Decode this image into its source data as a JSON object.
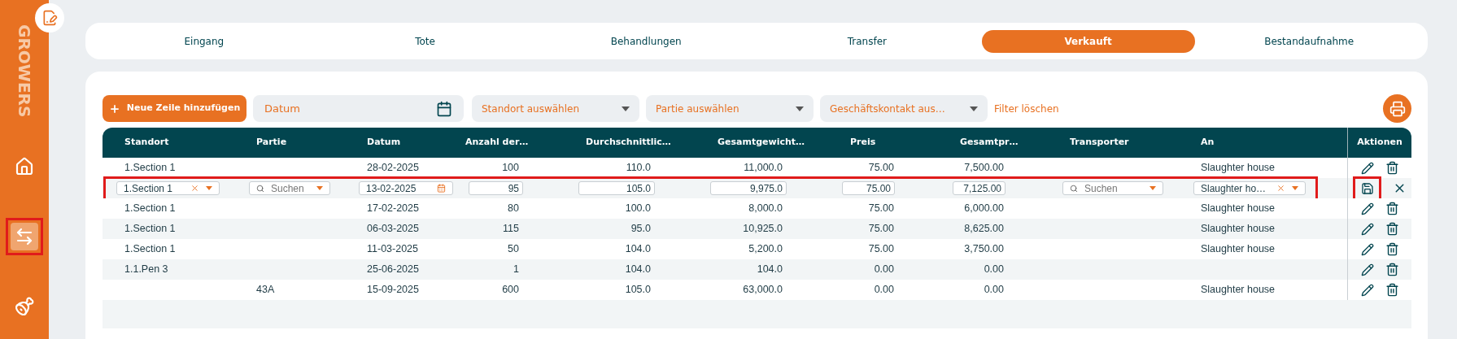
{
  "sidebar": {
    "brand": "GROWERS",
    "items": [
      {
        "kind": "home",
        "selected": false,
        "highlighted": false
      },
      {
        "kind": "transfer",
        "selected": true,
        "highlighted": true
      },
      {
        "kind": "ham",
        "selected": false,
        "highlighted": false
      }
    ]
  },
  "tabs": [
    {
      "label": "Eingang",
      "selected": false
    },
    {
      "label": "Tote",
      "selected": false
    },
    {
      "label": "Behandlungen",
      "selected": false
    },
    {
      "label": "Transfer",
      "selected": false
    },
    {
      "label": "Verkauft",
      "selected": true
    },
    {
      "label": "Bestandaufnahme",
      "selected": false
    }
  ],
  "toolbar": {
    "add_button": "Neue Zeile hinzufügen",
    "date_filter": {
      "placeholder": "Datum"
    },
    "selects": [
      {
        "placeholder": "Standort auswählen"
      },
      {
        "placeholder": "Partie auswählen"
      },
      {
        "placeholder": "Geschäftskontakt aus…"
      }
    ],
    "clear_filters": "Filter löschen"
  },
  "table": {
    "columns": [
      "Standort",
      "Partie",
      "Datum",
      "Anzahl der…",
      "Durchschnittlic…",
      "Gesamtgewicht…",
      "Preis",
      "Gesamtpr…",
      "Transporter",
      "An"
    ],
    "actions_column": "Aktionen",
    "rows": [
      {
        "kind": "view",
        "cells": [
          "1.Section 1",
          null,
          "28-02-2025",
          "100",
          "110.0",
          "11,000.0",
          "75.00",
          "7,500.00",
          null,
          "Slaughter house"
        ]
      },
      {
        "kind": "edit",
        "highlighted": true,
        "save_highlighted": true,
        "fields": [
          {
            "kind": "select",
            "value": "1.Section 1",
            "clearable": true
          },
          {
            "kind": "search",
            "placeholder": "Suchen"
          },
          {
            "kind": "date",
            "value": "13-02-2025"
          },
          {
            "kind": "number",
            "value": "95"
          },
          {
            "kind": "number",
            "value": "105.0"
          },
          {
            "kind": "number",
            "value": "9,975.0"
          },
          {
            "kind": "number",
            "value": "75.00"
          },
          {
            "kind": "number",
            "value": "7,125.00"
          },
          {
            "kind": "search",
            "placeholder": "Suchen"
          },
          {
            "kind": "select",
            "value": "Slaughter ho…",
            "clearable": true
          }
        ]
      },
      {
        "kind": "view",
        "cells": [
          "1.Section 1",
          null,
          "17-02-2025",
          "80",
          "100.0",
          "8,000.0",
          "75.00",
          "6,000.00",
          null,
          "Slaughter house"
        ]
      },
      {
        "kind": "view",
        "cells": [
          "1.Section 1",
          null,
          "06-03-2025",
          "115",
          "95.0",
          "10,925.0",
          "75.00",
          "8,625.00",
          null,
          "Slaughter house"
        ]
      },
      {
        "kind": "view",
        "cells": [
          "1.Section 1",
          null,
          "11-03-2025",
          "50",
          "104.0",
          "5,200.0",
          "75.00",
          "3,750.00",
          null,
          "Slaughter house"
        ]
      },
      {
        "kind": "view",
        "cells": [
          "1.1.Pen 3",
          null,
          "25-06-2025",
          "1",
          "104.0",
          "104.0",
          "0.00",
          "0.00",
          null,
          null
        ]
      },
      {
        "kind": "view",
        "cells": [
          null,
          "43A",
          "15-09-2025",
          "600",
          "105.0",
          "63,000.0",
          "0.00",
          "0.00",
          null,
          "Slaughter house"
        ]
      }
    ]
  }
}
